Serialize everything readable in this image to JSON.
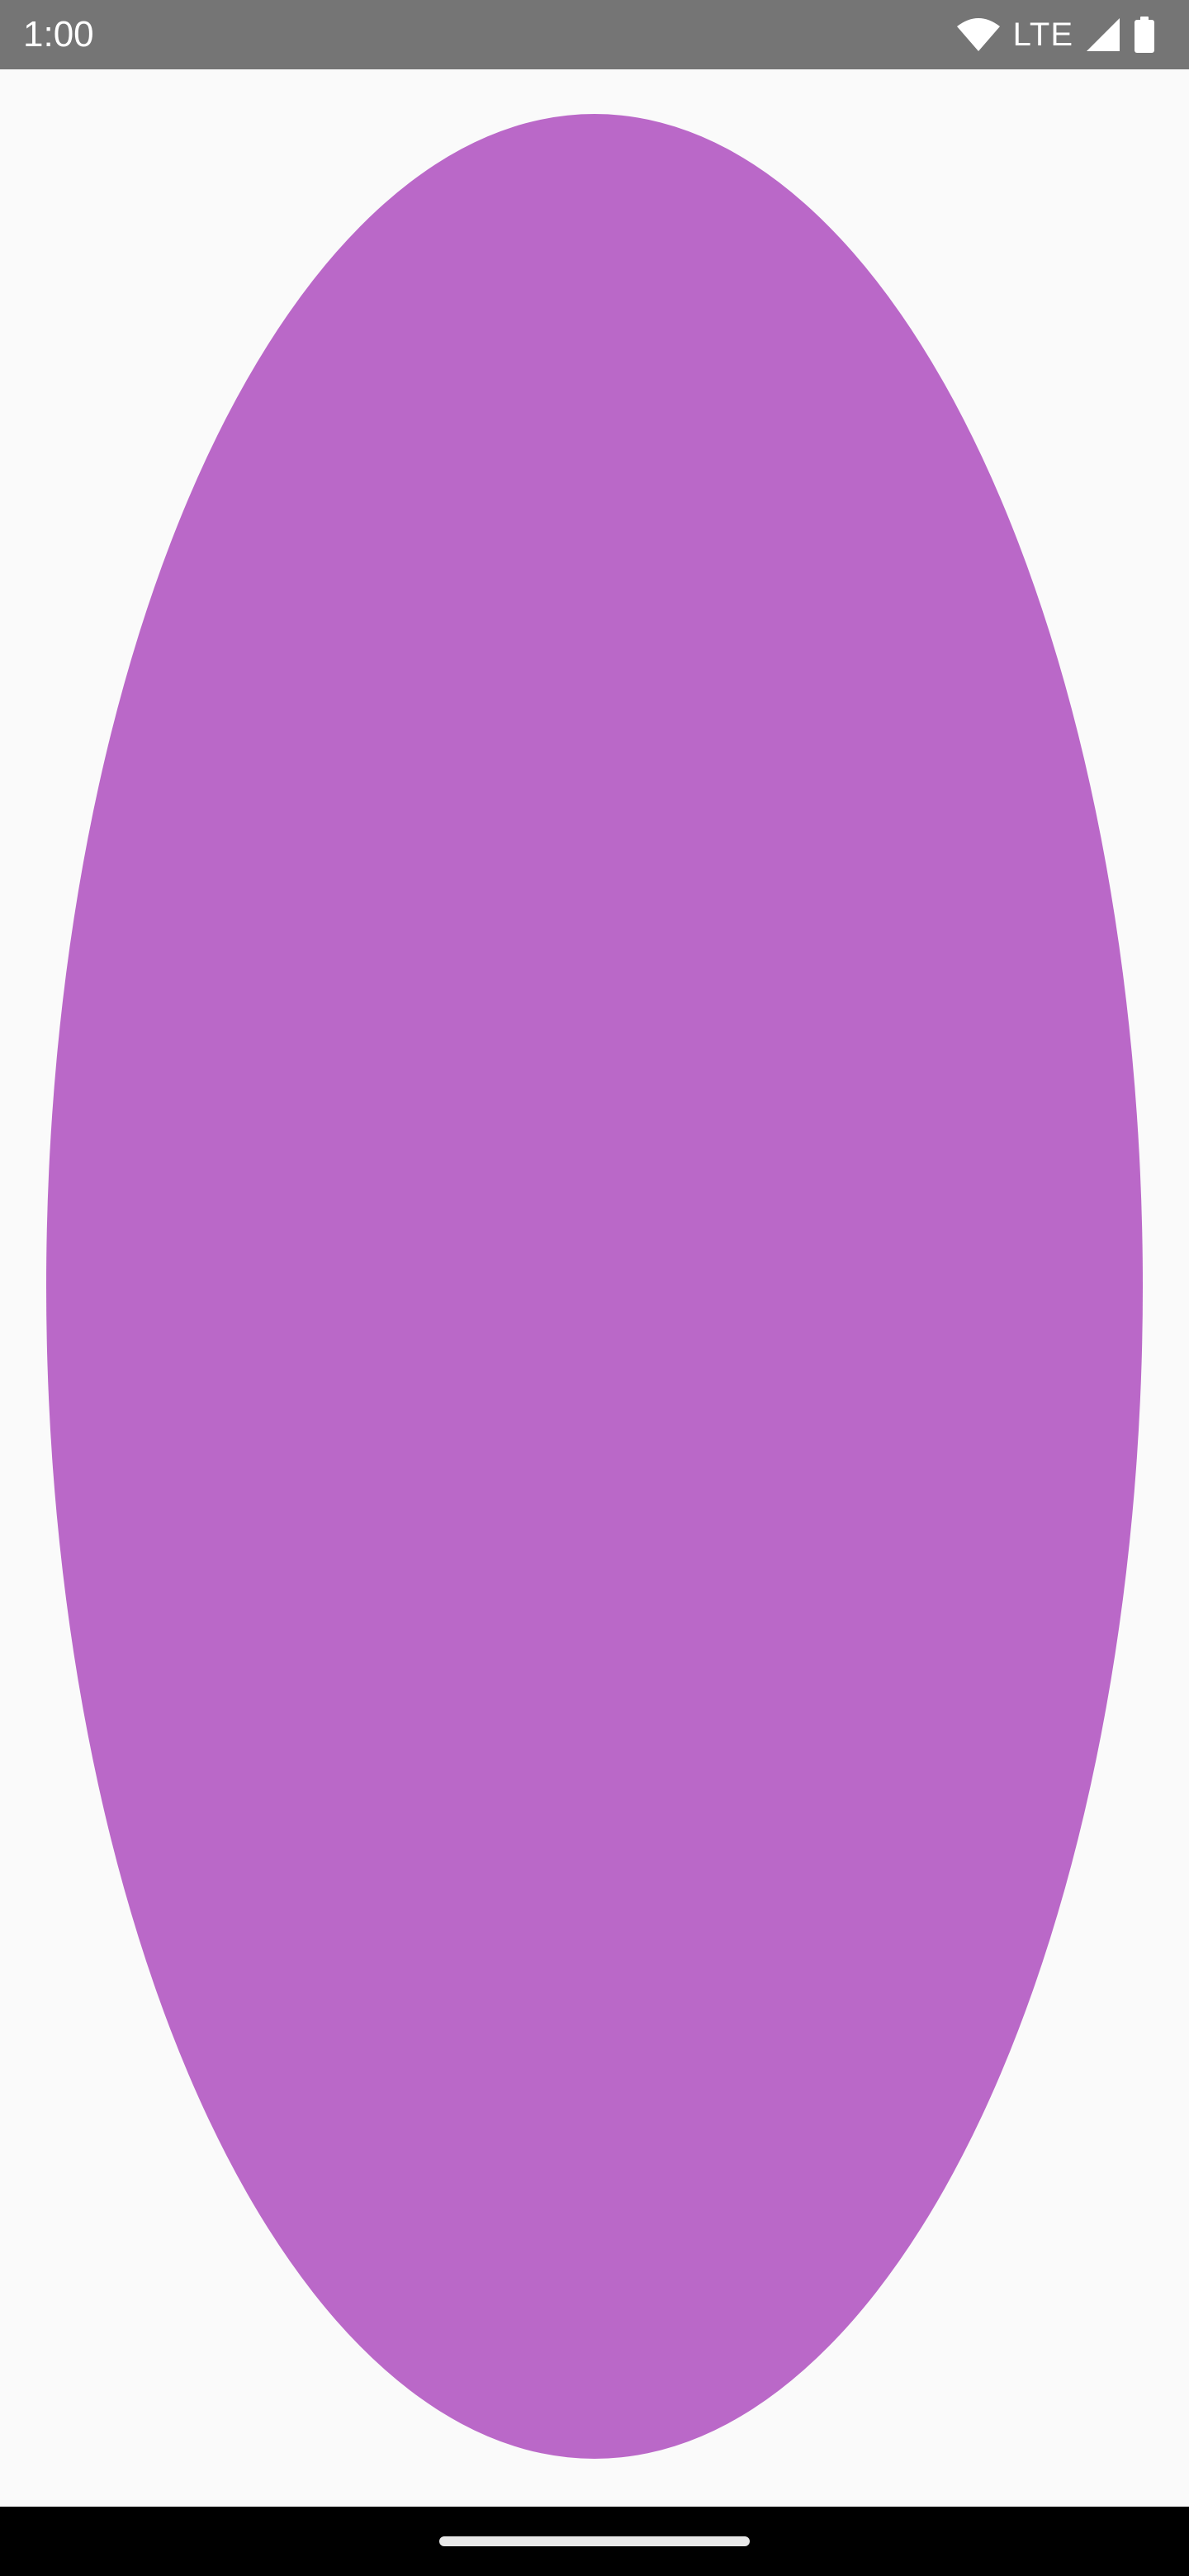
{
  "status_bar": {
    "time": "1:00",
    "network_label": "LTE",
    "icons": [
      "wifi-icon",
      "cell-signal-icon",
      "battery-icon"
    ]
  },
  "canvas": {
    "shape": "oval",
    "fill_color": "#ba68c8",
    "background_color": "#fafafa"
  },
  "nav_bar": {
    "handle": "home-handle"
  }
}
